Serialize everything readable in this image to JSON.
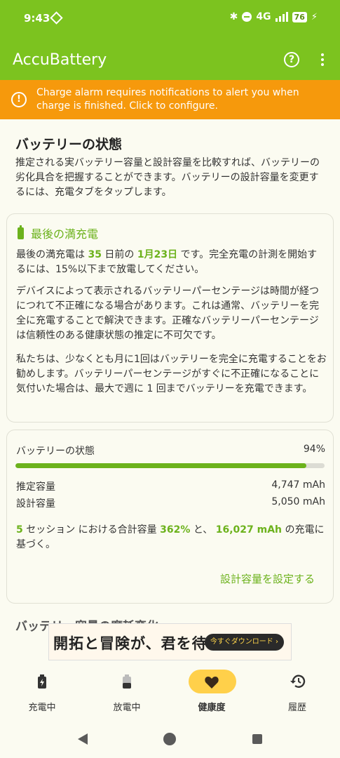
{
  "status": {
    "time": "9:43",
    "network": "4G",
    "battery": "76"
  },
  "app": {
    "title": "AccuBattery"
  },
  "banner": {
    "text": "Charge alarm requires notifications to alert you when charge is finished. Click to configure."
  },
  "section": {
    "title": "バッテリーの状態",
    "description": "推定される実バッテリー容量と設計容量を比較すれば、バッテリーの劣化具合を把握することができます。バッテリーの設計容量を変更するには、充電タブをタップします。"
  },
  "last_charge": {
    "title": "最後の満充電",
    "p1_a": "最後の満充電は ",
    "days": "35",
    "p1_b": " 日前の ",
    "date": "1月23日",
    "p1_c": " です。完全充電の計測を開始するには、15%以下まで放電してください。",
    "p2": "デバイスによって表示されるバッテリーパーセンテージは時間が経つにつれて不正確になる場合があります。これは通常、バッテリーを完全に充電することで解決できます。正確なバッテリーパーセンテージは信頼性のある健康状態の推定に不可欠です。",
    "p3": "私たちは、少なくとも月に1回はバッテリーを完全に充電することをお勧めします。バッテリーパーセンテージがすぐに不正確になることに気付いた場合は、最大で週に 1 回までバッテリーを充電できます。"
  },
  "health": {
    "label": "バッテリーの状態",
    "percent_text": "94%",
    "percent": 94,
    "estimated_label": "推定容量",
    "estimated_value": "4,747 mAh",
    "design_label": "設計容量",
    "design_value": "5,050 mAh",
    "sessions": "5",
    "s_a": " セッション における合計容量 ",
    "total_pct": "362%",
    "s_b": " と、 ",
    "charged": "16,027 mAh",
    "s_c": " の充電に基づく。",
    "set_design_link": "設計容量を設定する"
  },
  "peek_title": "バッテリー容量の摩耗変化",
  "ad": {
    "headline": "開拓と冒険が、君を待つ",
    "cta": "今すぐダウンロード ›"
  },
  "nav": {
    "charging": "充電中",
    "discharging": "放電中",
    "health": "健康度",
    "history": "履歴"
  },
  "colors": {
    "primary": "#7cc31f",
    "banner": "#f6990c",
    "accent_text": "#6cb21c",
    "active_pill": "#ffd04a"
  }
}
